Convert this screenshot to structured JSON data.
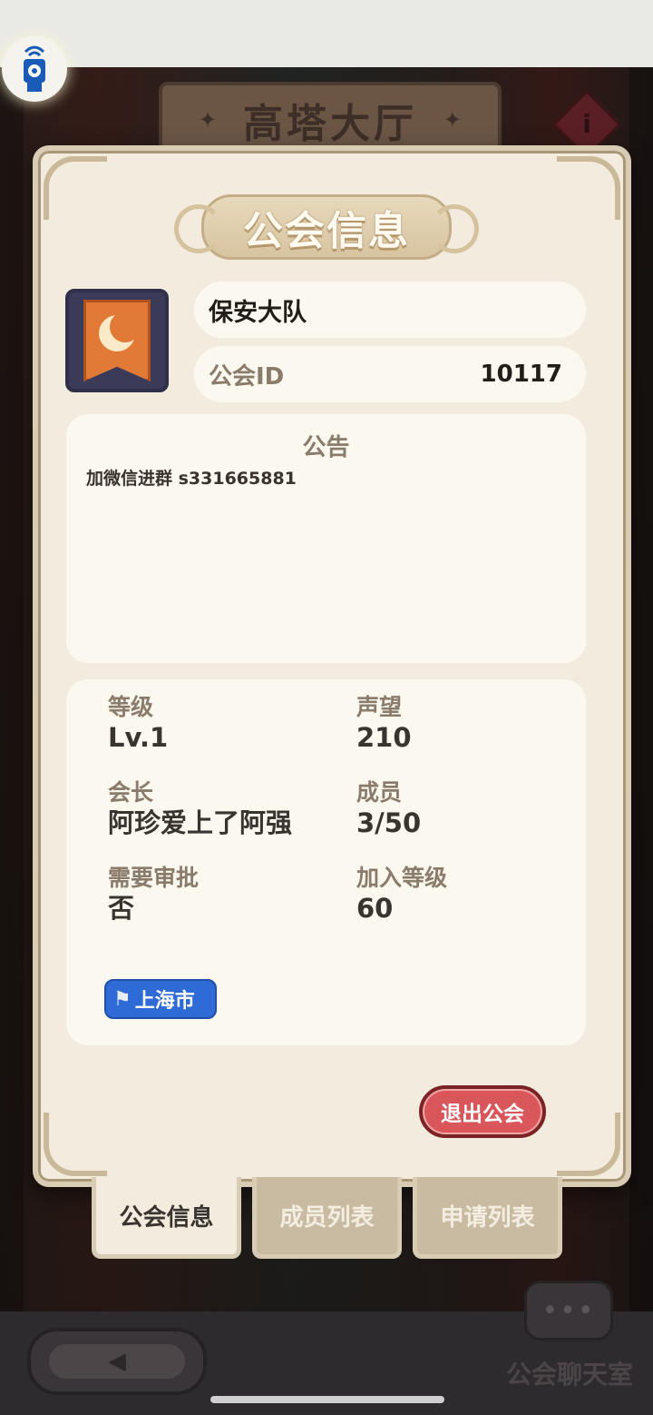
{
  "background": {
    "hall_title": "高塔大厅",
    "info_icon_glyph": "i",
    "chat_room_label": "公会聊天室",
    "chat_icon_glyph": "•••"
  },
  "modal": {
    "title": "公会信息",
    "guild_name": "保安大队",
    "guild_id_label": "公会ID",
    "guild_id_value": "10117",
    "notice_title": "公告",
    "notice_text": "加微信进群 s331665881",
    "stats": {
      "level_label": "等级",
      "level_value": "Lv.1",
      "prestige_label": "声望",
      "prestige_value": "210",
      "leader_label": "会长",
      "leader_value": "阿珍爱上了阿强",
      "members_label": "成员",
      "members_value": "3/50",
      "approval_label": "需要审批",
      "approval_value": "否",
      "join_level_label": "加入等级",
      "join_level_value": "60"
    },
    "location_tag": "上海市",
    "quit_button": "退出公会"
  },
  "tabs": [
    {
      "label": "公会信息",
      "active": true
    },
    {
      "label": "成员列表",
      "active": false
    },
    {
      "label": "申请列表",
      "active": false
    }
  ],
  "colors": {
    "panel_bg": "#f2ebde",
    "quit_button": "#d9575a",
    "location_tag": "#2f6bd6",
    "emblem_banner": "#e07a36"
  },
  "icons": {
    "signal_button": "signal-tower-icon",
    "emblem": "moon-banner-icon",
    "location": "flag-icon",
    "back": "back-arrow-icon",
    "chat": "chat-bubble-icon",
    "info": "info-icon"
  }
}
